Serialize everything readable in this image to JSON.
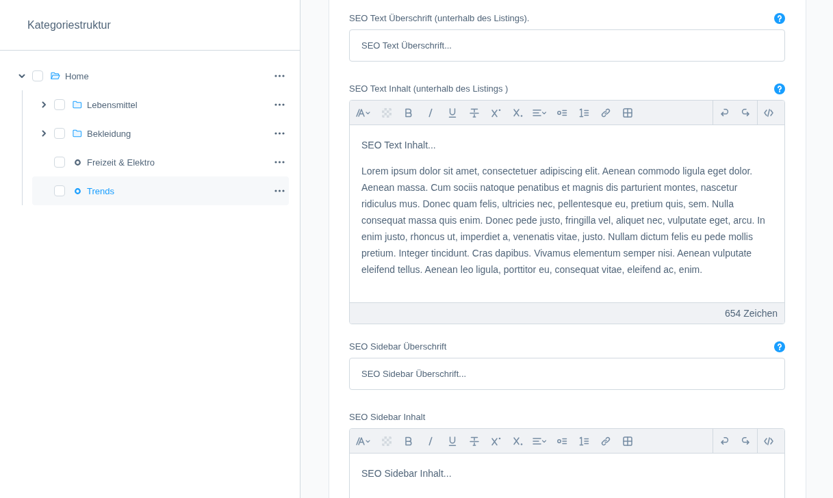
{
  "sidebar": {
    "title": "Kategoriestruktur",
    "tree": [
      {
        "label": "Home",
        "kind": "folder",
        "expanded": true,
        "checked": false,
        "selected": false,
        "children": [
          {
            "label": "Lebensmittel",
            "kind": "folder",
            "expanded": false,
            "checked": false,
            "selected": false
          },
          {
            "label": "Bekleidung",
            "kind": "folder",
            "expanded": false,
            "checked": false,
            "selected": false
          },
          {
            "label": "Freizeit & Elektro",
            "kind": "leaf",
            "checked": false,
            "selected": false
          },
          {
            "label": "Trends",
            "kind": "leaf",
            "checked": false,
            "selected": true
          }
        ]
      }
    ]
  },
  "form": {
    "fields": [
      {
        "kind": "input",
        "label": "SEO Text Überschrift (unterhalb des Listings).",
        "help": true,
        "placeholder": "SEO Text Überschrift..."
      },
      {
        "kind": "editor",
        "label": "SEO Text Inhalt (unterhalb des Listings )",
        "help": true,
        "content": [
          "SEO Text Inhalt...",
          "Lorem ipsum dolor sit amet, consectetuer adipiscing elit. Aenean commodo ligula eget dolor. Aenean massa. Cum sociis natoque penatibus et magnis dis parturient montes, nascetur ridiculus mus. Donec quam felis, ultricies nec, pellentesque eu, pretium quis, sem. Nulla consequat massa quis enim. Donec pede justo, fringilla vel, aliquet nec, vulputate eget, arcu. In enim justo, rhoncus ut, imperdiet a, venenatis vitae, justo. Nullam dictum felis eu pede mollis pretium. Integer tincidunt. Cras dapibus. Vivamus elementum semper nisi. Aenean vulputate eleifend tellus. Aenean leo ligula, porttitor eu, consequat vitae, eleifend ac, enim."
        ],
        "char_count": "654 Zeichen"
      },
      {
        "kind": "input",
        "label": "SEO Sidebar Überschrift",
        "help": true,
        "placeholder": "SEO Sidebar Überschrift..."
      },
      {
        "kind": "editor",
        "label": "SEO Sidebar Inhalt",
        "help": false,
        "content": [
          "SEO Sidebar Inhalt..."
        ]
      }
    ]
  }
}
